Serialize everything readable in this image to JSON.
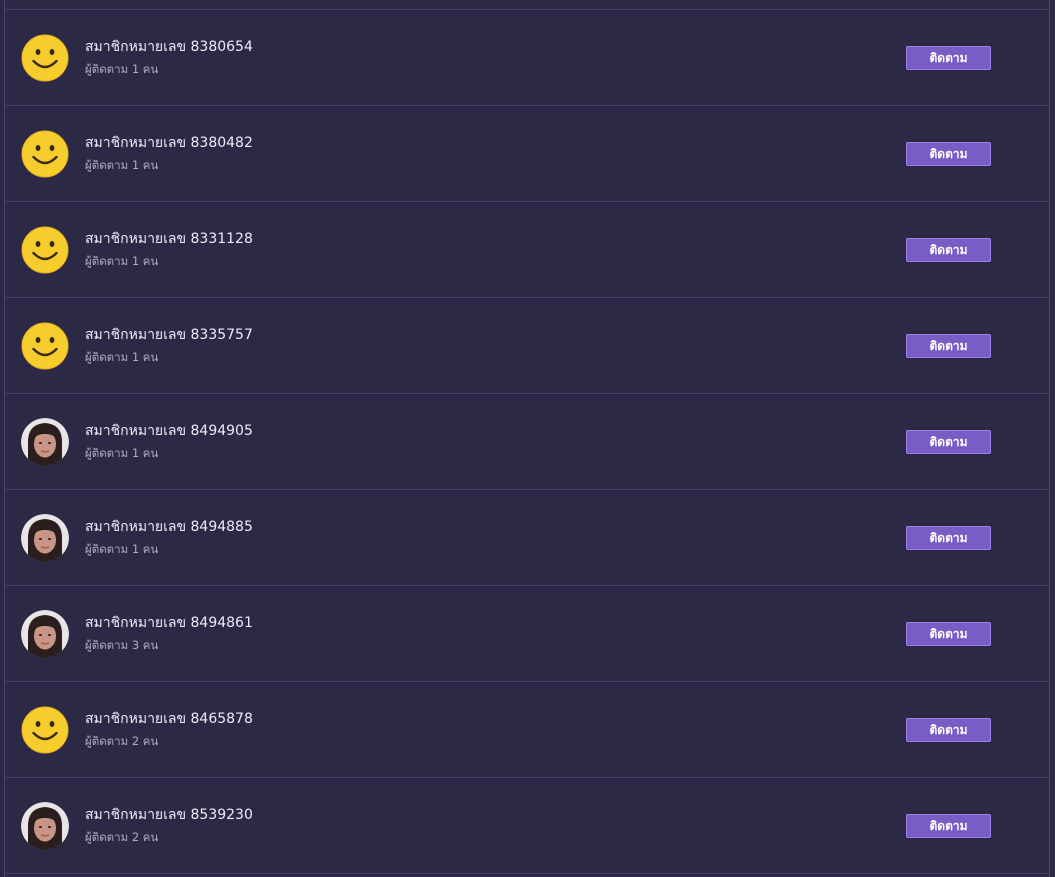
{
  "members": [
    {
      "name": "สมาชิกหมายเลข 8380654",
      "followers": "ผู้ติดตาม 1 คน",
      "avatar": "smiley-icon",
      "button": "ติดตาม"
    },
    {
      "name": "สมาชิกหมายเลข 8380482",
      "followers": "ผู้ติดตาม 1 คน",
      "avatar": "smiley-icon",
      "button": "ติดตาม"
    },
    {
      "name": "สมาชิกหมายเลข 8331128",
      "followers": "ผู้ติดตาม 1 คน",
      "avatar": "smiley-icon",
      "button": "ติดตาม"
    },
    {
      "name": "สมาชิกหมายเลข 8335757",
      "followers": "ผู้ติดตาม 1 คน",
      "avatar": "smiley-icon",
      "button": "ติดตาม"
    },
    {
      "name": "สมาชิกหมายเลข 8494905",
      "followers": "ผู้ติดตาม 1 คน",
      "avatar": "profile-photo",
      "button": "ติดตาม"
    },
    {
      "name": "สมาชิกหมายเลข 8494885",
      "followers": "ผู้ติดตาม 1 คน",
      "avatar": "profile-photo",
      "button": "ติดตาม"
    },
    {
      "name": "สมาชิกหมายเลข 8494861",
      "followers": "ผู้ติดตาม 3 คน",
      "avatar": "profile-photo",
      "button": "ติดตาม"
    },
    {
      "name": "สมาชิกหมายเลข 8465878",
      "followers": "ผู้ติดตาม 2 คน",
      "avatar": "smiley-icon",
      "button": "ติดตาม"
    },
    {
      "name": "สมาชิกหมายเลข 8539230",
      "followers": "ผู้ติดตาม 2 คน",
      "avatar": "profile-photo",
      "button": "ติดตาม"
    }
  ],
  "colors": {
    "background": "#2c2946",
    "divider": "#45426a",
    "button": "#7a5cc7",
    "name_text": "#ecebf5",
    "subtext": "#aeaac8",
    "smiley": "#f7cd2e"
  }
}
